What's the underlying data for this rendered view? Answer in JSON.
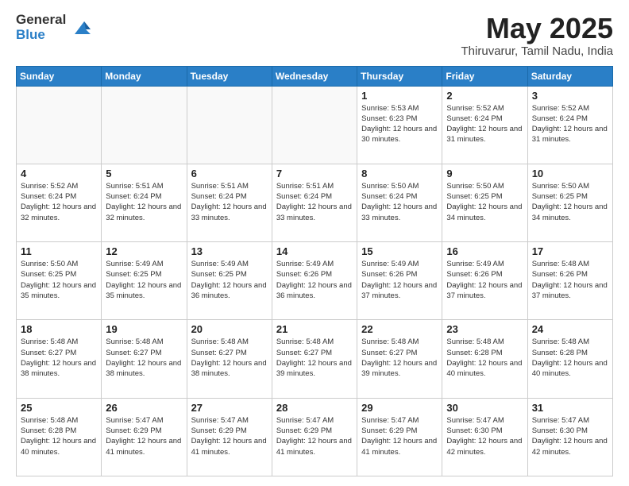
{
  "logo": {
    "line1": "General",
    "line2": "Blue"
  },
  "header": {
    "month": "May 2025",
    "location": "Thiruvarur, Tamil Nadu, India"
  },
  "weekdays": [
    "Sunday",
    "Monday",
    "Tuesday",
    "Wednesday",
    "Thursday",
    "Friday",
    "Saturday"
  ],
  "weeks": [
    [
      {
        "day": "",
        "info": ""
      },
      {
        "day": "",
        "info": ""
      },
      {
        "day": "",
        "info": ""
      },
      {
        "day": "",
        "info": ""
      },
      {
        "day": "1",
        "info": "Sunrise: 5:53 AM\nSunset: 6:23 PM\nDaylight: 12 hours\nand 30 minutes."
      },
      {
        "day": "2",
        "info": "Sunrise: 5:52 AM\nSunset: 6:24 PM\nDaylight: 12 hours\nand 31 minutes."
      },
      {
        "day": "3",
        "info": "Sunrise: 5:52 AM\nSunset: 6:24 PM\nDaylight: 12 hours\nand 31 minutes."
      }
    ],
    [
      {
        "day": "4",
        "info": "Sunrise: 5:52 AM\nSunset: 6:24 PM\nDaylight: 12 hours\nand 32 minutes."
      },
      {
        "day": "5",
        "info": "Sunrise: 5:51 AM\nSunset: 6:24 PM\nDaylight: 12 hours\nand 32 minutes."
      },
      {
        "day": "6",
        "info": "Sunrise: 5:51 AM\nSunset: 6:24 PM\nDaylight: 12 hours\nand 33 minutes."
      },
      {
        "day": "7",
        "info": "Sunrise: 5:51 AM\nSunset: 6:24 PM\nDaylight: 12 hours\nand 33 minutes."
      },
      {
        "day": "8",
        "info": "Sunrise: 5:50 AM\nSunset: 6:24 PM\nDaylight: 12 hours\nand 33 minutes."
      },
      {
        "day": "9",
        "info": "Sunrise: 5:50 AM\nSunset: 6:25 PM\nDaylight: 12 hours\nand 34 minutes."
      },
      {
        "day": "10",
        "info": "Sunrise: 5:50 AM\nSunset: 6:25 PM\nDaylight: 12 hours\nand 34 minutes."
      }
    ],
    [
      {
        "day": "11",
        "info": "Sunrise: 5:50 AM\nSunset: 6:25 PM\nDaylight: 12 hours\nand 35 minutes."
      },
      {
        "day": "12",
        "info": "Sunrise: 5:49 AM\nSunset: 6:25 PM\nDaylight: 12 hours\nand 35 minutes."
      },
      {
        "day": "13",
        "info": "Sunrise: 5:49 AM\nSunset: 6:25 PM\nDaylight: 12 hours\nand 36 minutes."
      },
      {
        "day": "14",
        "info": "Sunrise: 5:49 AM\nSunset: 6:26 PM\nDaylight: 12 hours\nand 36 minutes."
      },
      {
        "day": "15",
        "info": "Sunrise: 5:49 AM\nSunset: 6:26 PM\nDaylight: 12 hours\nand 37 minutes."
      },
      {
        "day": "16",
        "info": "Sunrise: 5:49 AM\nSunset: 6:26 PM\nDaylight: 12 hours\nand 37 minutes."
      },
      {
        "day": "17",
        "info": "Sunrise: 5:48 AM\nSunset: 6:26 PM\nDaylight: 12 hours\nand 37 minutes."
      }
    ],
    [
      {
        "day": "18",
        "info": "Sunrise: 5:48 AM\nSunset: 6:27 PM\nDaylight: 12 hours\nand 38 minutes."
      },
      {
        "day": "19",
        "info": "Sunrise: 5:48 AM\nSunset: 6:27 PM\nDaylight: 12 hours\nand 38 minutes."
      },
      {
        "day": "20",
        "info": "Sunrise: 5:48 AM\nSunset: 6:27 PM\nDaylight: 12 hours\nand 38 minutes."
      },
      {
        "day": "21",
        "info": "Sunrise: 5:48 AM\nSunset: 6:27 PM\nDaylight: 12 hours\nand 39 minutes."
      },
      {
        "day": "22",
        "info": "Sunrise: 5:48 AM\nSunset: 6:27 PM\nDaylight: 12 hours\nand 39 minutes."
      },
      {
        "day": "23",
        "info": "Sunrise: 5:48 AM\nSunset: 6:28 PM\nDaylight: 12 hours\nand 40 minutes."
      },
      {
        "day": "24",
        "info": "Sunrise: 5:48 AM\nSunset: 6:28 PM\nDaylight: 12 hours\nand 40 minutes."
      }
    ],
    [
      {
        "day": "25",
        "info": "Sunrise: 5:48 AM\nSunset: 6:28 PM\nDaylight: 12 hours\nand 40 minutes."
      },
      {
        "day": "26",
        "info": "Sunrise: 5:47 AM\nSunset: 6:29 PM\nDaylight: 12 hours\nand 41 minutes."
      },
      {
        "day": "27",
        "info": "Sunrise: 5:47 AM\nSunset: 6:29 PM\nDaylight: 12 hours\nand 41 minutes."
      },
      {
        "day": "28",
        "info": "Sunrise: 5:47 AM\nSunset: 6:29 PM\nDaylight: 12 hours\nand 41 minutes."
      },
      {
        "day": "29",
        "info": "Sunrise: 5:47 AM\nSunset: 6:29 PM\nDaylight: 12 hours\nand 41 minutes."
      },
      {
        "day": "30",
        "info": "Sunrise: 5:47 AM\nSunset: 6:30 PM\nDaylight: 12 hours\nand 42 minutes."
      },
      {
        "day": "31",
        "info": "Sunrise: 5:47 AM\nSunset: 6:30 PM\nDaylight: 12 hours\nand 42 minutes."
      }
    ]
  ]
}
